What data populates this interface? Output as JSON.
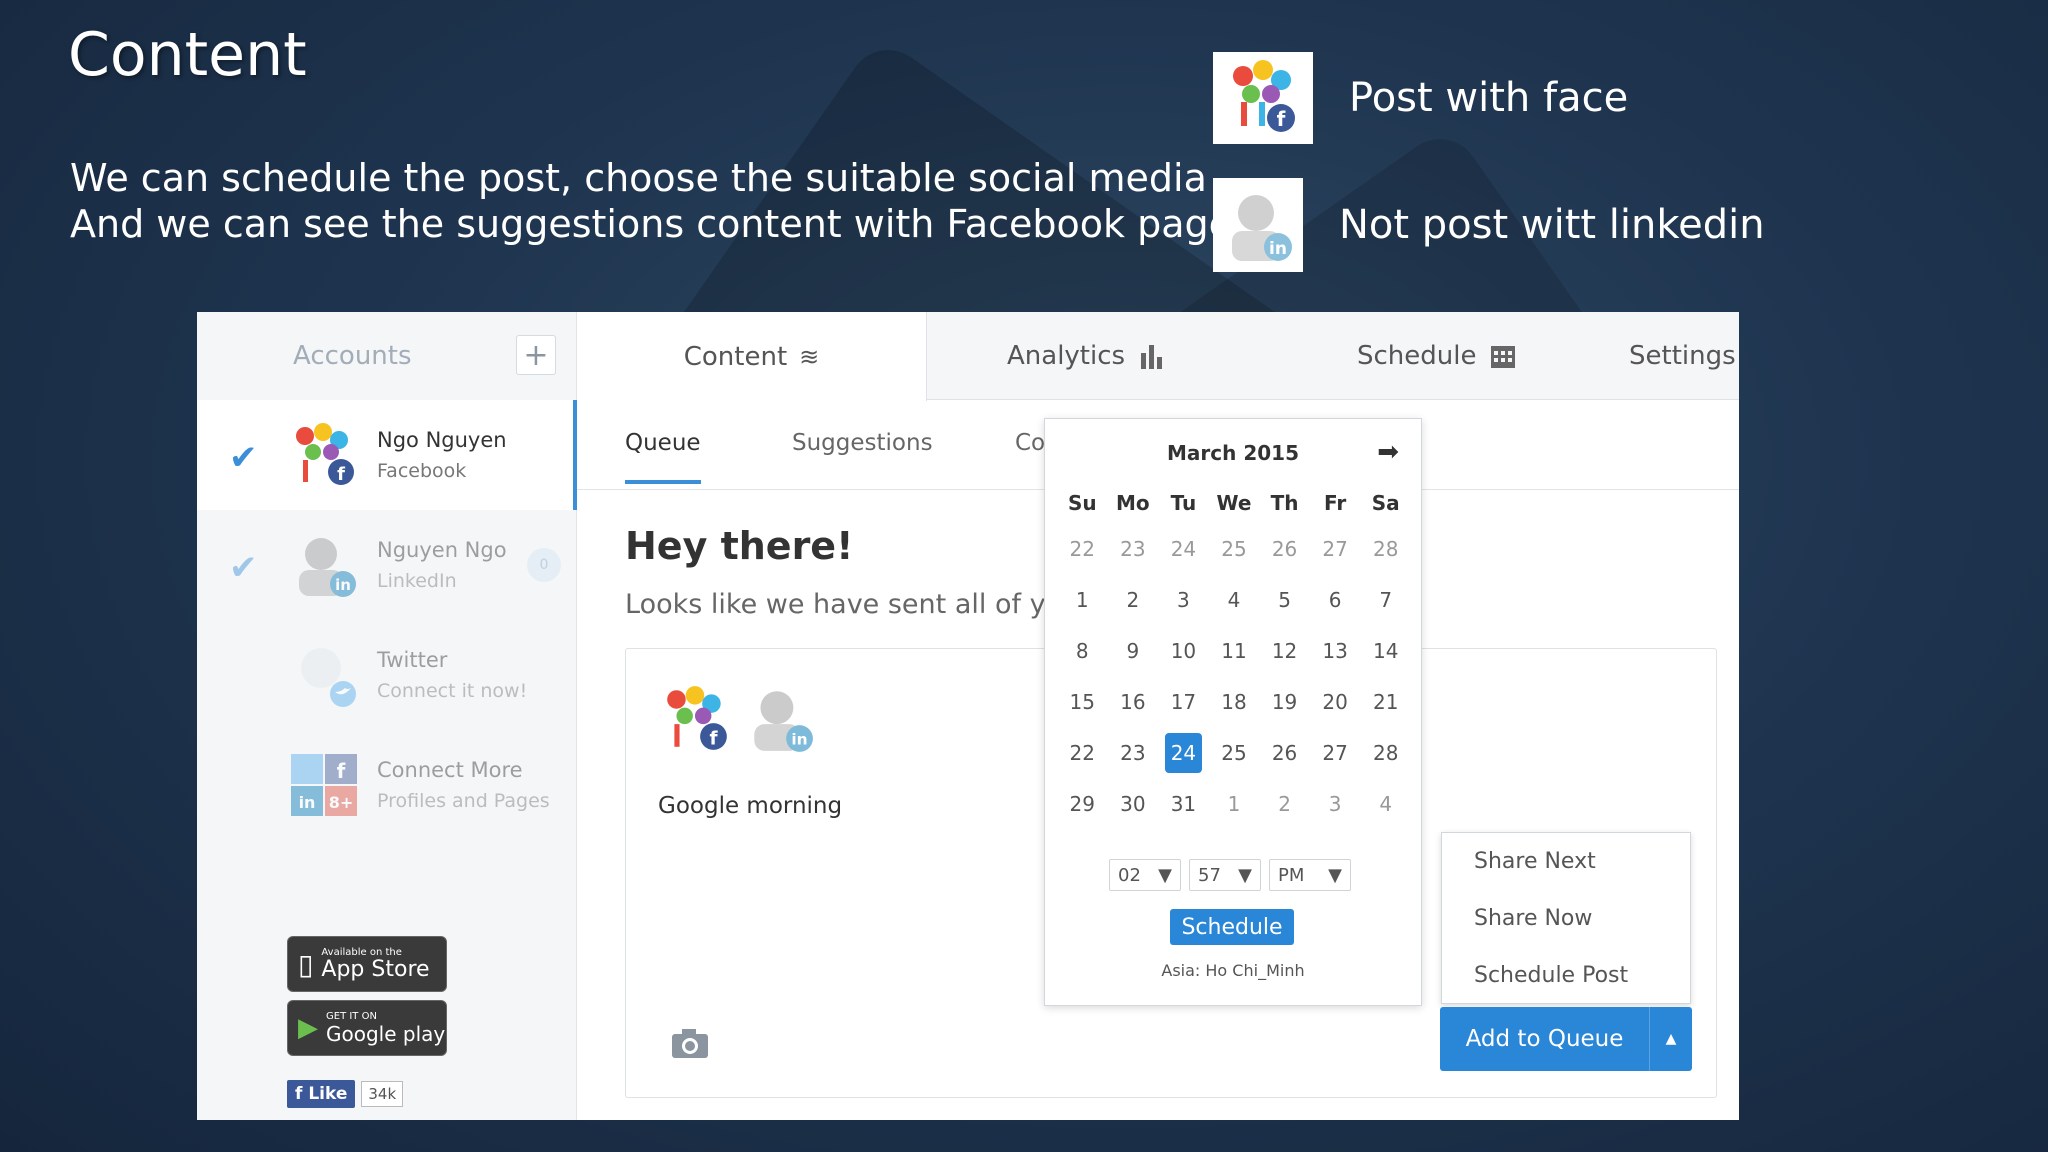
{
  "slide": {
    "title": "Content",
    "desc_line1": "We can schedule the post, choose the suitable social media",
    "desc_line2": "And we can see the suggestions content with Facebook pages",
    "legend": [
      {
        "label": "Post with face"
      },
      {
        "label": "Not post witt linkedin"
      }
    ]
  },
  "sidebar": {
    "accounts_label": "Accounts",
    "add_label": "+",
    "accounts": [
      {
        "name": "Ngo Nguyen",
        "network": "Facebook"
      },
      {
        "name": "Nguyen Ngo",
        "network": "LinkedIn",
        "badge": "0"
      },
      {
        "name": "Twitter",
        "network": "Connect it now!"
      },
      {
        "name": "Connect More",
        "network": "Profiles and Pages"
      }
    ],
    "appstore_small": "Available on the",
    "appstore_big": "App Store",
    "googleplay_small": "GET IT ON",
    "googleplay_big": "Google play",
    "like_label": "Like",
    "like_count": "34k"
  },
  "topnav": {
    "content": "Content",
    "analytics": "Analytics",
    "schedule": "Schedule",
    "settings": "Settings"
  },
  "subtabs": {
    "queue": "Queue",
    "suggestions": "Suggestions",
    "third": "Co"
  },
  "main": {
    "greeting": "Hey there!",
    "message": "Looks like we have sent all of yo",
    "post_text": "Google morning"
  },
  "calendar": {
    "month": "March 2015",
    "days_of_week": [
      "Su",
      "Mo",
      "Tu",
      "We",
      "Th",
      "Fr",
      "Sa"
    ],
    "weeks": [
      [
        "22",
        "23",
        "24",
        "25",
        "26",
        "27",
        "28"
      ],
      [
        "1",
        "2",
        "3",
        "4",
        "5",
        "6",
        "7"
      ],
      [
        "8",
        "9",
        "10",
        "11",
        "12",
        "13",
        "14"
      ],
      [
        "15",
        "16",
        "17",
        "18",
        "19",
        "20",
        "21"
      ],
      [
        "22",
        "23",
        "24",
        "25",
        "26",
        "27",
        "28"
      ],
      [
        "29",
        "30",
        "31",
        "1",
        "2",
        "3",
        "4"
      ]
    ],
    "selected_day": "24",
    "hour": "02",
    "minute": "57",
    "ampm": "PM",
    "schedule_label": "Schedule",
    "timezone": "Asia: Ho Chi_Minh"
  },
  "queue_menu": {
    "items": [
      "Share Next",
      "Share Now",
      "Schedule Post"
    ],
    "add_label": "Add to Queue"
  },
  "colors": {
    "accent": "#2a87d8",
    "facebook": "#3b5998",
    "linkedin": "#0077b5",
    "twitter": "#55acee"
  }
}
